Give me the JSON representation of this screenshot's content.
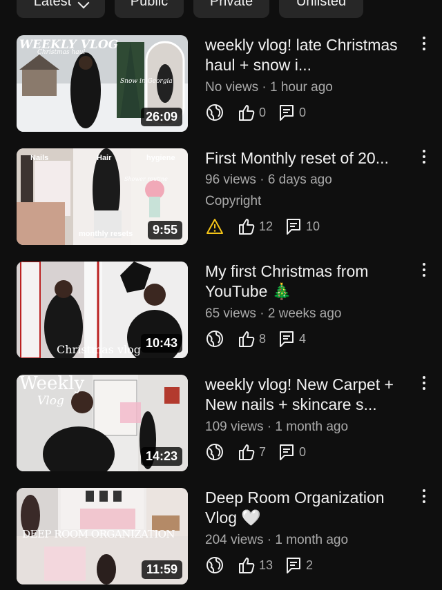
{
  "filters": [
    {
      "label": "Latest",
      "has_dropdown": true
    },
    {
      "label": "Public"
    },
    {
      "label": "Private"
    },
    {
      "label": "Unlisted"
    }
  ],
  "videos": [
    {
      "title": "weekly vlog! late Christmas haul + snow i...",
      "duration": "26:09",
      "views": "No views",
      "age": "1 hour ago",
      "visibility_icon": "globe-icon",
      "likes": "0",
      "comments": "0",
      "thumb_text": {
        "top": "WEEKLY VLOG",
        "sub": "Christmas haul",
        "tag": "Snow in Georgia"
      }
    },
    {
      "title": "First Monthly reset of 20...",
      "duration": "9:55",
      "views": "96 views",
      "age": "6 days ago",
      "extra": "Copyright",
      "visibility_icon": "warning-icon",
      "likes": "12",
      "comments": "10",
      "thumb_text": {
        "a": "Nails",
        "b": "Hair",
        "c": "hygiene",
        "d": "Shower routine",
        "e": "monthly resets"
      }
    },
    {
      "title": "My first Christmas from YouTube 🎄",
      "duration": "10:43",
      "views": "65 views",
      "age": "2 weeks ago",
      "visibility_icon": "globe-icon",
      "likes": "8",
      "comments": "4",
      "thumb_text": {
        "bottom": "Christmas vlog"
      }
    },
    {
      "title": "weekly vlog!  New Carpet + New nails + skincare s...",
      "duration": "14:23",
      "views": "109 views",
      "age": "1 month ago",
      "visibility_icon": "globe-icon",
      "likes": "7",
      "comments": "0",
      "thumb_text": {
        "top": "Weekly",
        "sub": "Vlog"
      }
    },
    {
      "title": "Deep Room Organization Vlog 🤍",
      "duration": "11:59",
      "views": "204 views",
      "age": "1 month ago",
      "visibility_icon": "globe-icon",
      "likes": "13",
      "comments": "2",
      "thumb_text": {
        "mid": "DEEP ROOM ORGANIZATION"
      }
    }
  ],
  "separator": "·",
  "colors": {
    "background": "#0f0f0f",
    "chip": "#272727",
    "text": "#f1f1f1",
    "secondary": "#aaaaaa",
    "warning": "#f5c518"
  }
}
